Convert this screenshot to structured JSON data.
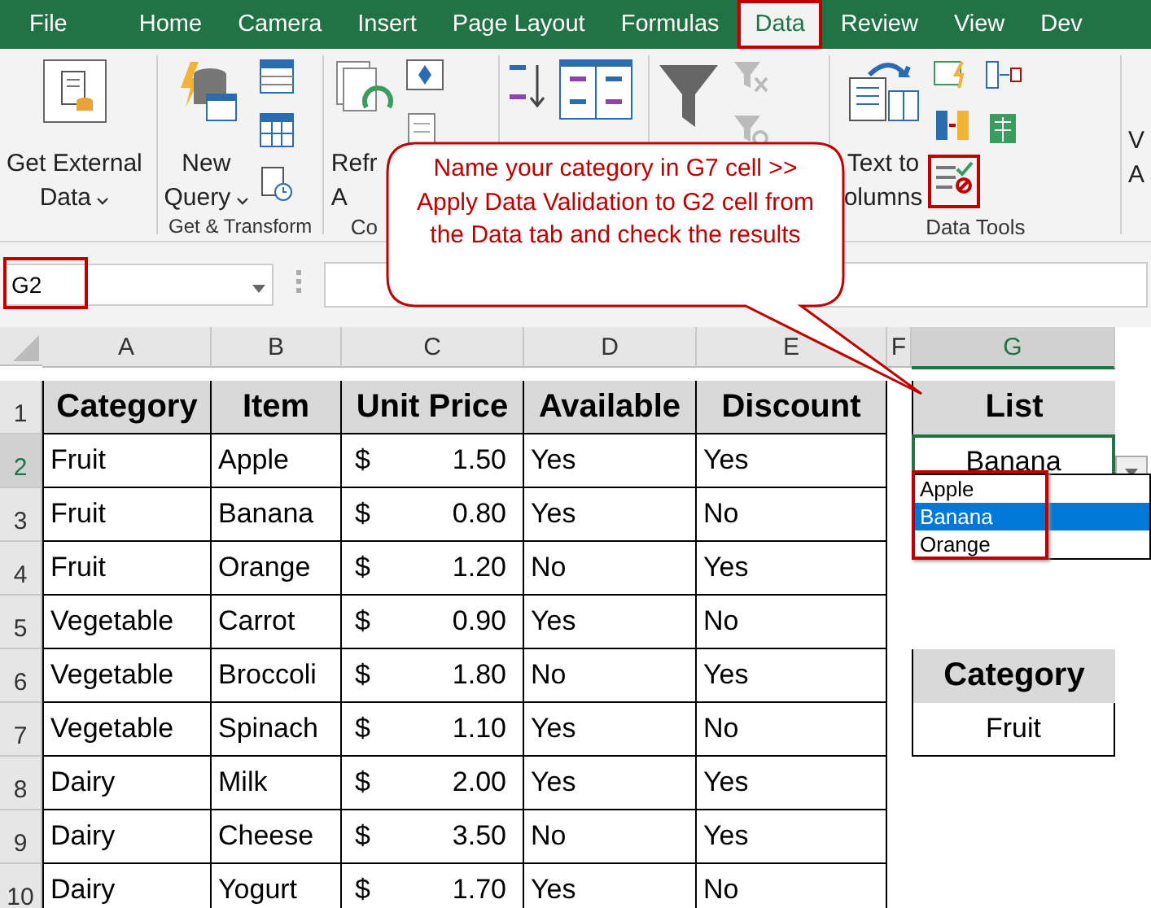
{
  "ribbon_tabs": [
    {
      "label": "File",
      "selected": false
    },
    {
      "label": "Home",
      "selected": false
    },
    {
      "label": "Camera",
      "selected": false
    },
    {
      "label": "Insert",
      "selected": false
    },
    {
      "label": "Page Layout",
      "selected": false
    },
    {
      "label": "Formulas",
      "selected": false
    },
    {
      "label": "Data",
      "selected": true
    },
    {
      "label": "Review",
      "selected": false
    },
    {
      "label": "View",
      "selected": false
    },
    {
      "label": "Dev",
      "selected": false
    }
  ],
  "ribbon_groups": [
    {
      "kind": "external",
      "buttons": [
        {
          "lines": [
            "Get External",
            "Data"
          ],
          "caret": true
        }
      ]
    },
    {
      "kind": "query",
      "label": "Get & Transform",
      "buttons": [
        {
          "lines": [
            "New",
            "Query"
          ],
          "caret": true
        }
      ]
    },
    {
      "kind": "connections",
      "label": "Co",
      "buttons": [
        {
          "lines": [
            "Refr",
            "A"
          ],
          "caret": false
        }
      ]
    },
    {
      "kind": "tools",
      "label": "Data Tools",
      "buttons": [
        {
          "lines": [
            "Text to",
            "olumns"
          ],
          "caret": false
        }
      ]
    },
    {
      "kind": "edge",
      "buttons": [
        {
          "lines": [
            "V",
            "A"
          ],
          "caret": false
        }
      ]
    }
  ],
  "name_box": {
    "value": "G2",
    "highlighted": true
  },
  "callout": {
    "text": "Name your category in G7 cell >> Apply Data Validation to G2 cell from the Data tab and check the results"
  },
  "columns": [
    {
      "label": "A",
      "selected": false
    },
    {
      "label": "B",
      "selected": false
    },
    {
      "label": "C",
      "selected": false
    },
    {
      "label": "D",
      "selected": false
    },
    {
      "label": "E",
      "selected": false
    },
    {
      "label": "F",
      "selected": false
    },
    {
      "label": "G",
      "selected": true
    }
  ],
  "row_numbers": [
    {
      "label": "1",
      "selected": false
    },
    {
      "label": "2",
      "selected": true
    },
    {
      "label": "3",
      "selected": false
    },
    {
      "label": "4",
      "selected": false
    },
    {
      "label": "5",
      "selected": false
    },
    {
      "label": "6",
      "selected": false
    },
    {
      "label": "7",
      "selected": false
    },
    {
      "label": "8",
      "selected": false
    },
    {
      "label": "9",
      "selected": false
    },
    {
      "label": "10",
      "selected": false
    }
  ],
  "table": {
    "headers": [
      "Category",
      "Item",
      "Unit Price",
      "Available",
      "Discount"
    ],
    "rows": [
      {
        "category": "Fruit",
        "item": "Apple",
        "currency": "$",
        "price": "1.50",
        "available": "Yes",
        "discount": "Yes"
      },
      {
        "category": "Fruit",
        "item": "Banana",
        "currency": "$",
        "price": "0.80",
        "available": "Yes",
        "discount": "No"
      },
      {
        "category": "Fruit",
        "item": "Orange",
        "currency": "$",
        "price": "1.20",
        "available": "No",
        "discount": "Yes"
      },
      {
        "category": "Vegetable",
        "item": "Carrot",
        "currency": "$",
        "price": "0.90",
        "available": "Yes",
        "discount": "No"
      },
      {
        "category": "Vegetable",
        "item": "Broccoli",
        "currency": "$",
        "price": "1.80",
        "available": "No",
        "discount": "Yes"
      },
      {
        "category": "Vegetable",
        "item": "Spinach",
        "currency": "$",
        "price": "1.10",
        "available": "Yes",
        "discount": "No"
      },
      {
        "category": "Dairy",
        "item": "Milk",
        "currency": "$",
        "price": "2.00",
        "available": "Yes",
        "discount": "Yes"
      },
      {
        "category": "Dairy",
        "item": "Cheese",
        "currency": "$",
        "price": "3.50",
        "available": "No",
        "discount": "Yes"
      },
      {
        "category": "Dairy",
        "item": "Yogurt",
        "currency": "$",
        "price": "1.70",
        "available": "Yes",
        "discount": "No"
      }
    ]
  },
  "list_cell": {
    "header": "List",
    "value": "Banana",
    "active": true
  },
  "dropdown": {
    "highlighted": true,
    "options": [
      {
        "label": "Apple",
        "selected": false
      },
      {
        "label": "Banana",
        "selected": true
      },
      {
        "label": "Orange",
        "selected": false
      }
    ]
  },
  "category_cell": {
    "header": "Category",
    "value": "Fruit"
  }
}
